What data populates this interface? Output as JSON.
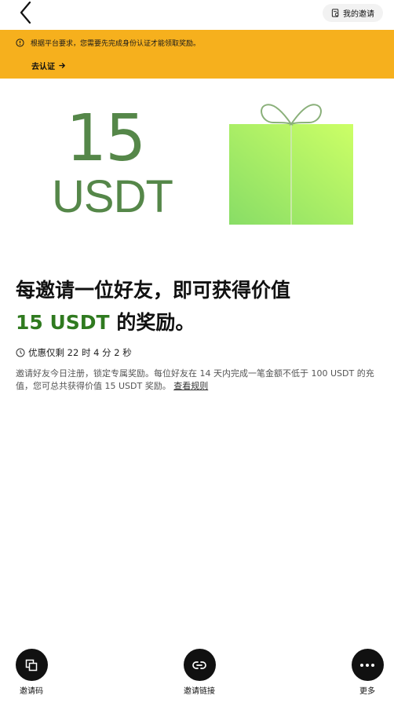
{
  "header": {
    "my_invites_label": "我的邀请"
  },
  "banner": {
    "message": "根据平台要求，您需要先完成身份认证才能领取奖励。",
    "action_label": "去认证",
    "background_color": "#f6b01d"
  },
  "hero": {
    "amount": "15",
    "unit": "USDT",
    "accent_color": "#558749",
    "icon": "gift-icon"
  },
  "headline": {
    "line1": "每邀请一位好友，即可获得价值",
    "amount_text": "15 USDT",
    "suffix": "的奖励。",
    "highlight_color": "#2f7a1f"
  },
  "timer": {
    "text": "优惠仅剩 22 时 4 分 2 秒"
  },
  "description": {
    "text": "邀请好友今日注册，锁定专属奖励。每位好友在 14 天内完成一笔金额不低于 100 USDT 的充值，您可总共获得价值 15 USDT 奖励。",
    "rules_link": "查看规则"
  },
  "bottom_actions": [
    {
      "label": "邀请码",
      "icon": "copy-icon"
    },
    {
      "label": "邀请链接",
      "icon": "link-icon"
    },
    {
      "label": "更多",
      "icon": "more-icon"
    }
  ]
}
